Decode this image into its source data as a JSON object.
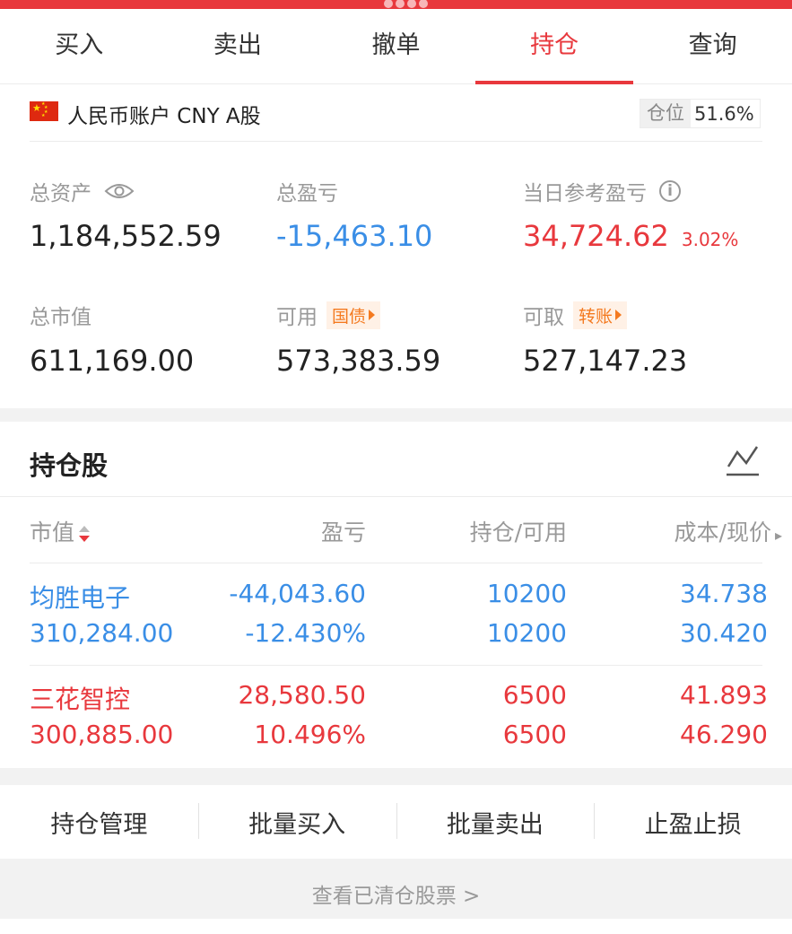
{
  "tabs": [
    {
      "label": "买入",
      "active": false
    },
    {
      "label": "卖出",
      "active": false
    },
    {
      "label": "撤单",
      "active": false
    },
    {
      "label": "持仓",
      "active": true
    },
    {
      "label": "查询",
      "active": false
    }
  ],
  "account": {
    "name": "人民币账户 CNY A股",
    "position_label": "仓位",
    "position_value": "51.6%"
  },
  "summary": {
    "total_assets_label": "总资产",
    "total_assets": "1,184,552.59",
    "total_pnl_label": "总盈亏",
    "total_pnl": "-15,463.10",
    "daily_pnl_label": "当日参考盈亏",
    "daily_pnl": "34,724.62",
    "daily_pnl_pct": "3.02%",
    "market_value_label": "总市值",
    "market_value": "611,169.00",
    "available_label": "可用",
    "available_badge": "国债",
    "available": "573,383.59",
    "withdrawable_label": "可取",
    "withdrawable_badge": "转账",
    "withdrawable": "527,147.23"
  },
  "holdings": {
    "title": "持仓股",
    "headers": [
      "市值",
      "盈亏",
      "持仓/可用",
      "成本/现价"
    ],
    "rows": [
      {
        "name": "均胜电子",
        "market_value": "310,284.00",
        "pnl": "-44,043.60",
        "pnl_pct": "-12.430%",
        "position": "10200",
        "available": "10200",
        "cost": "34.738",
        "price": "30.420",
        "color": "#3a8ee6"
      },
      {
        "name": "三花智控",
        "market_value": "300,885.00",
        "pnl": "28,580.50",
        "pnl_pct": "10.496%",
        "position": "6500",
        "available": "6500",
        "cost": "41.893",
        "price": "46.290",
        "color": "#e8383d"
      }
    ]
  },
  "actions": [
    "持仓管理",
    "批量买入",
    "批量卖出",
    "止盈止损"
  ],
  "footer": "查看已清仓股票 >"
}
